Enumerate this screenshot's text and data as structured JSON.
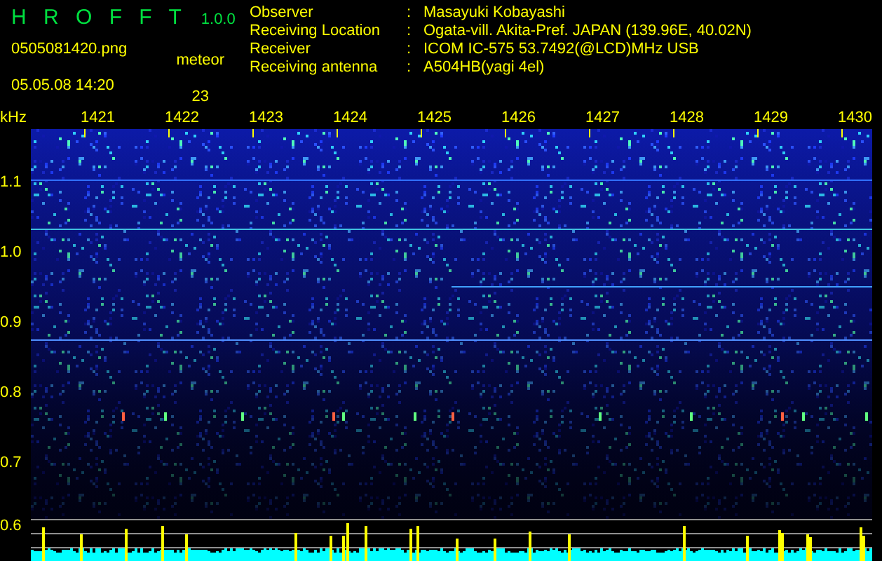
{
  "header": {
    "title": "H R O F F T",
    "version": "1.0.0",
    "file": "0505081420.png",
    "datetime": "05.05.08 14:20",
    "meteor_label": "meteor",
    "meteor_count": "23"
  },
  "info": [
    {
      "label": "Observer",
      "separator": ":",
      "value": "Masayuki Kobayashi"
    },
    {
      "label": "Receiving Location",
      "separator": ":",
      "value": "Ogata-vill. Akita-Pref. JAPAN (139.96E, 40.02N)"
    },
    {
      "label": "Receiver",
      "separator": ":",
      "value": "ICOM IC-575 53.7492(@LCD)MHz USB"
    },
    {
      "label": "Receiving antenna",
      "separator": ":",
      "value": "A504HB(yagi 4el)"
    }
  ],
  "axis_unit": "kHz",
  "minute_labels": [
    "1421",
    "1422",
    "1423",
    "1424",
    "1425",
    "1426",
    "1427",
    "1428",
    "1429",
    "1430"
  ],
  "frequency_labels": [
    "1.1",
    "1.0",
    "0.9",
    "0.8",
    "0.7",
    "0.6"
  ]
}
